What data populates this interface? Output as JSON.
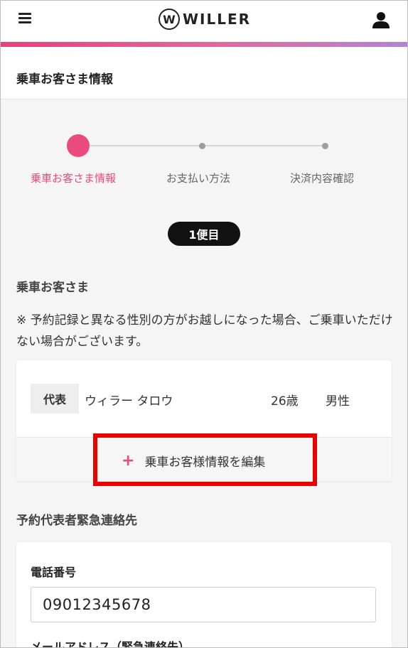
{
  "header": {
    "logo_mark": "W",
    "logo_text": "WILLER"
  },
  "page": {
    "title": "乗車お客さま情報"
  },
  "stepper": {
    "steps": [
      {
        "label": "乗車お客さま情報",
        "active": true
      },
      {
        "label": "お支払い方法",
        "active": false
      },
      {
        "label": "決済内容確認",
        "active": false
      }
    ]
  },
  "flight_badge": "1便目",
  "passengers_section": {
    "heading": "乗車お客さま",
    "notice": "※ 予約記録と異なる性別の方がお越しになった場合、ご乗車いただけない場合がございます。",
    "passenger": {
      "badge": "代表",
      "name": "ウィラー タロウ",
      "age": "26歳",
      "gender": "男性"
    },
    "edit_button": "乗車お客様情報を編集"
  },
  "emergency_section": {
    "heading": "予約代表者緊急連絡先",
    "phone_label": "電話番号",
    "phone_value": "09012345678",
    "email_label": "メールアドレス（緊急連絡先）"
  },
  "colors": {
    "accent": "#ea4a7c",
    "highlight_box": "#ee0000"
  }
}
